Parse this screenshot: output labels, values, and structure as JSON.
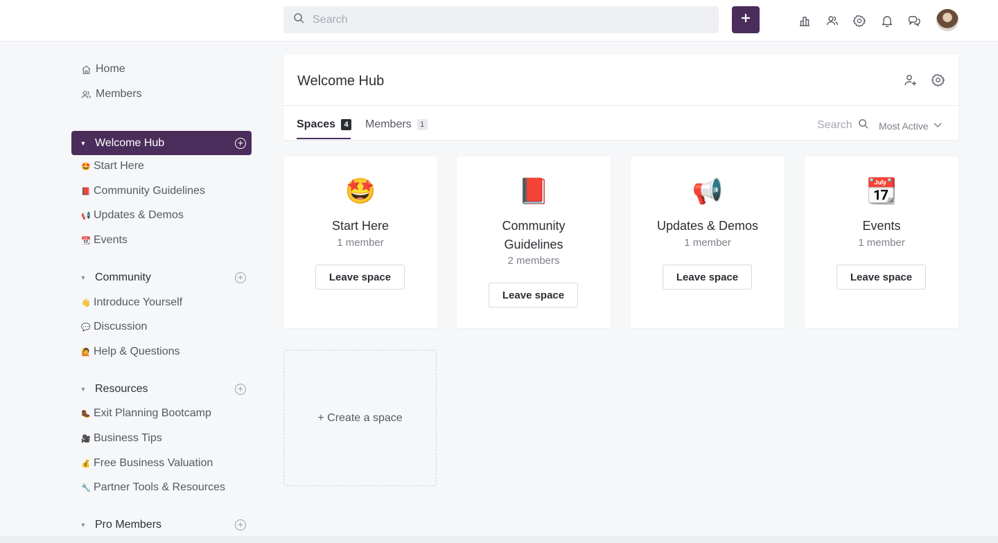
{
  "topbar": {
    "search_placeholder": "Search",
    "icons": [
      "leaderboard-icon",
      "members-icon",
      "settings-icon",
      "notifications-icon",
      "messages-icon"
    ],
    "accent_color": "#4a2d5a"
  },
  "sidebar": {
    "links": [
      {
        "label": "Home",
        "icon": "home-icon"
      },
      {
        "label": "Members",
        "icon": "members-icon"
      }
    ],
    "groups": [
      {
        "title": "Welcome Hub",
        "active": true,
        "items": [
          {
            "emoji": "🤩",
            "label": "Start Here"
          },
          {
            "emoji": "📕",
            "label": "Community Guidelines"
          },
          {
            "emoji": "📢",
            "label": "Updates & Demos"
          },
          {
            "emoji": "📆",
            "label": "Events"
          }
        ]
      },
      {
        "title": "Community",
        "active": false,
        "items": [
          {
            "emoji": "👋",
            "label": "Introduce Yourself"
          },
          {
            "emoji": "💬",
            "label": "Discussion"
          },
          {
            "emoji": "🙋",
            "label": "Help & Questions"
          }
        ]
      },
      {
        "title": "Resources",
        "active": false,
        "items": [
          {
            "emoji": "🥾",
            "label": "Exit Planning Bootcamp"
          },
          {
            "emoji": "🎥",
            "label": "Business Tips"
          },
          {
            "emoji": "💰",
            "label": "Free Business Valuation"
          },
          {
            "emoji": "🔧",
            "label": "Partner Tools & Resources"
          }
        ]
      },
      {
        "title": "Pro Members",
        "active": false,
        "items": []
      }
    ]
  },
  "main": {
    "title": "Welcome Hub",
    "tabs": [
      {
        "label": "Spaces",
        "count": "4",
        "active": true
      },
      {
        "label": "Members",
        "count": "1",
        "active": false
      }
    ],
    "search_label": "Search",
    "sort_label": "Most Active",
    "cards": [
      {
        "emoji": "🤩",
        "name": "Start Here",
        "members": "1 member",
        "button": "Leave space"
      },
      {
        "emoji": "📕",
        "name": "Community Guidelines",
        "members": "2 members",
        "button": "Leave space"
      },
      {
        "emoji": "📢",
        "name": "Updates & Demos",
        "members": "1 member",
        "button": "Leave space"
      },
      {
        "emoji": "📆",
        "name": "Events",
        "members": "1 member",
        "button": "Leave space"
      }
    ],
    "create_label": "+ Create a space"
  }
}
